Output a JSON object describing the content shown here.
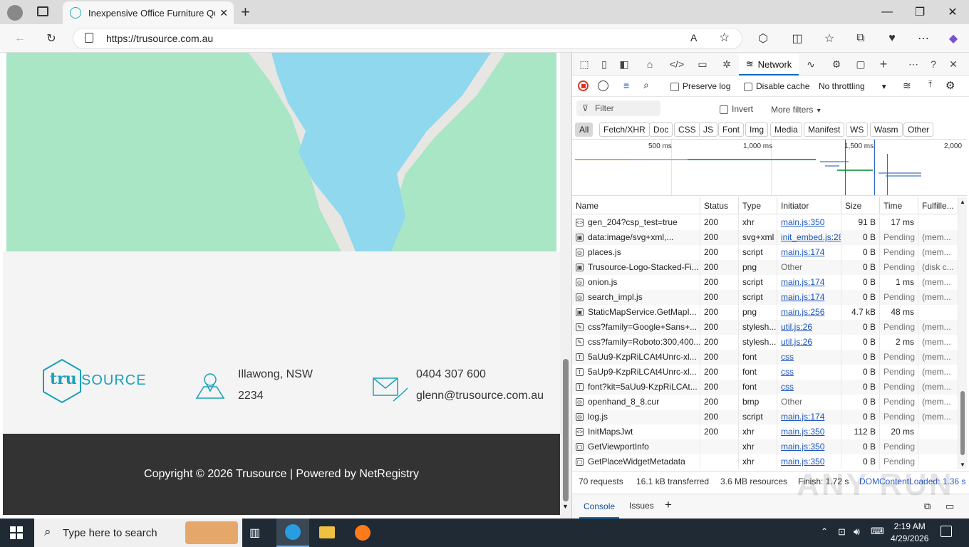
{
  "browser": {
    "tab_title": "Inexpensive Office Furniture Quot",
    "new_tab": "+",
    "url": "https://trusource.com.au",
    "window": {
      "minimize": "—",
      "restore": "❐",
      "close": "✕"
    }
  },
  "page": {
    "logo_text_a": "tru",
    "logo_text_b": "SOURCE",
    "address_line1": "Illawong, NSW",
    "address_line2": "2234",
    "phone": "0404 307 600",
    "email": "glenn@trusource.com.au",
    "footer": "Copyright © 2026 Trusource | Powered by NetRegistry"
  },
  "devtools": {
    "network_tab": "Network",
    "preserve_log": "Preserve log",
    "disable_cache": "Disable cache",
    "throttling": "No throttling",
    "filter_placeholder": "Filter",
    "invert": "Invert",
    "more_filters": "More filters",
    "chips": [
      "All",
      "Fetch/XHR",
      "Doc",
      "CSS",
      "JS",
      "Font",
      "Img",
      "Media",
      "Manifest",
      "WS",
      "Wasm",
      "Other"
    ],
    "ticks": [
      "500 ms",
      "1,000 ms",
      "1,500 ms",
      "2,000"
    ],
    "columns": {
      "name": "Name",
      "status": "Status",
      "type": "Type",
      "initiator": "Initiator",
      "size": "Size",
      "time": "Time",
      "fulfilled": "Fulfille..."
    },
    "rows": [
      {
        "icon": "<>",
        "name": "gen_204?csp_test=true",
        "status": "200",
        "type": "xhr",
        "initiator": "main.js:350",
        "size": "91 B",
        "time": "17 ms",
        "ful": ""
      },
      {
        "icon": "▣",
        "name": "data:image/svg+xml,...",
        "status": "200",
        "type": "svg+xml",
        "initiator": "init_embed.js:28",
        "size": "0 B",
        "time": "Pending",
        "ful": "(mem..."
      },
      {
        "icon": "◎",
        "name": "places.js",
        "status": "200",
        "type": "script",
        "initiator": "main.js:174",
        "size": "0 B",
        "time": "Pending",
        "ful": "(mem..."
      },
      {
        "icon": "▣",
        "name": "Trusource-Logo-Stacked-Fi...",
        "status": "200",
        "type": "png",
        "initiator": "Other",
        "size": "0 B",
        "time": "Pending",
        "ful": "(disk c..."
      },
      {
        "icon": "◎",
        "name": "onion.js",
        "status": "200",
        "type": "script",
        "initiator": "main.js:174",
        "size": "0 B",
        "time": "1 ms",
        "ful": "(mem..."
      },
      {
        "icon": "◎",
        "name": "search_impl.js",
        "status": "200",
        "type": "script",
        "initiator": "main.js:174",
        "size": "0 B",
        "time": "Pending",
        "ful": "(mem..."
      },
      {
        "icon": "▣",
        "name": "StaticMapService.GetMapI...",
        "status": "200",
        "type": "png",
        "initiator": "main.js:256",
        "size": "4.7 kB",
        "time": "48 ms",
        "ful": ""
      },
      {
        "icon": "✎",
        "name": "css?family=Google+Sans+...",
        "status": "200",
        "type": "stylesh...",
        "initiator": "util.js:26",
        "size": "0 B",
        "time": "Pending",
        "ful": "(mem..."
      },
      {
        "icon": "✎",
        "name": "css?family=Roboto:300,400...",
        "status": "200",
        "type": "stylesh...",
        "initiator": "util.js:26",
        "size": "0 B",
        "time": "2 ms",
        "ful": "(mem..."
      },
      {
        "icon": "T",
        "name": "5aUu9-KzpRiLCAt4Unrc-xl...",
        "status": "200",
        "type": "font",
        "initiator": "css",
        "size": "0 B",
        "time": "Pending",
        "ful": "(mem..."
      },
      {
        "icon": "T",
        "name": "5aUp9-KzpRiLCAt4Unrc-xl...",
        "status": "200",
        "type": "font",
        "initiator": "css",
        "size": "0 B",
        "time": "Pending",
        "ful": "(mem..."
      },
      {
        "icon": "T",
        "name": "font?kit=5aUu9-KzpRiLCAt...",
        "status": "200",
        "type": "font",
        "initiator": "css",
        "size": "0 B",
        "time": "Pending",
        "ful": "(mem..."
      },
      {
        "icon": "◎",
        "name": "openhand_8_8.cur",
        "status": "200",
        "type": "bmp",
        "initiator": "Other",
        "size": "0 B",
        "time": "Pending",
        "ful": "(mem..."
      },
      {
        "icon": "◎",
        "name": "log.js",
        "status": "200",
        "type": "script",
        "initiator": "main.js:174",
        "size": "0 B",
        "time": "Pending",
        "ful": "(mem..."
      },
      {
        "icon": "<>",
        "name": "InitMapsJwt",
        "status": "200",
        "type": "xhr",
        "initiator": "main.js:350",
        "size": "112 B",
        "time": "20 ms",
        "ful": ""
      },
      {
        "icon": "▢",
        "name": "GetViewportInfo",
        "status": "",
        "type": "xhr",
        "initiator": "main.js:350",
        "size": "0 B",
        "time": "Pending",
        "ful": ""
      },
      {
        "icon": "▢",
        "name": "GetPlaceWidgetMetadata",
        "status": "",
        "type": "xhr",
        "initiator": "main.js:350",
        "size": "0 B",
        "time": "Pending",
        "ful": ""
      }
    ],
    "status": {
      "requests": "70 requests",
      "transferred": "16.1 kB transferred",
      "resources": "3.6 MB resources",
      "finish": "Finish: 1.72 s",
      "dcl": "DOMContentLoaded: 1.36 s"
    },
    "drawer": {
      "console": "Console",
      "issues": "Issues"
    }
  },
  "taskbar": {
    "search_placeholder": "Type here to search",
    "time": "2:19 AM",
    "date": "4/29/2026"
  },
  "watermark": "ANY RUN"
}
